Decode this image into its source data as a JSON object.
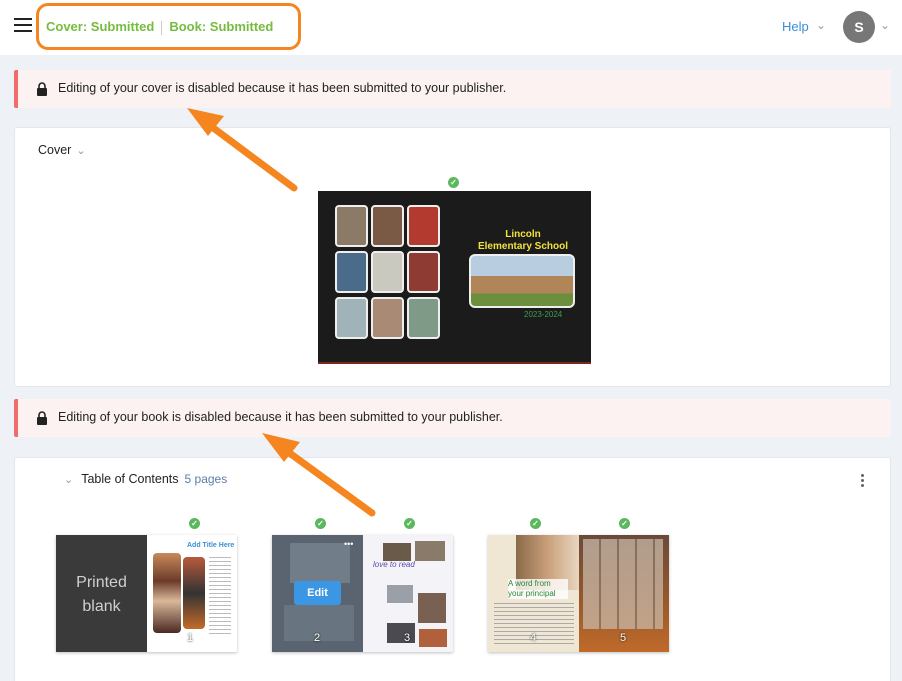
{
  "header": {
    "cover_status": "Cover: Submitted",
    "book_status": "Book: Submitted",
    "help_label": "Help",
    "avatar_initial": "S"
  },
  "alerts": {
    "cover": "Editing of your cover is disabled because it has been submitted to your publisher.",
    "book": "Editing of your book is disabled because it has been submitted to your publisher."
  },
  "cover_section": {
    "title": "Cover",
    "school_line1": "Lincoln",
    "school_line2": "Elementary School",
    "year": "2023-2024"
  },
  "toc_section": {
    "title": "Table of Contents",
    "page_count": "5 pages"
  },
  "spreads": [
    {
      "left_label_1": "Printed",
      "left_label_2": "blank",
      "right_heading": "Add Title Here",
      "right_num": "1"
    },
    {
      "edit_label": "Edit",
      "right_heading": "love to read",
      "left_num": "2",
      "right_num": "3"
    },
    {
      "left_heading": "A word from your principal",
      "left_num": "4",
      "right_num": "5"
    }
  ],
  "colors": {
    "accent_green": "#76bc3f",
    "highlight_orange": "#f5861f",
    "alert_red": "#f26b6b",
    "link_blue": "#3b8fd8",
    "check_green": "#5cb85c"
  }
}
